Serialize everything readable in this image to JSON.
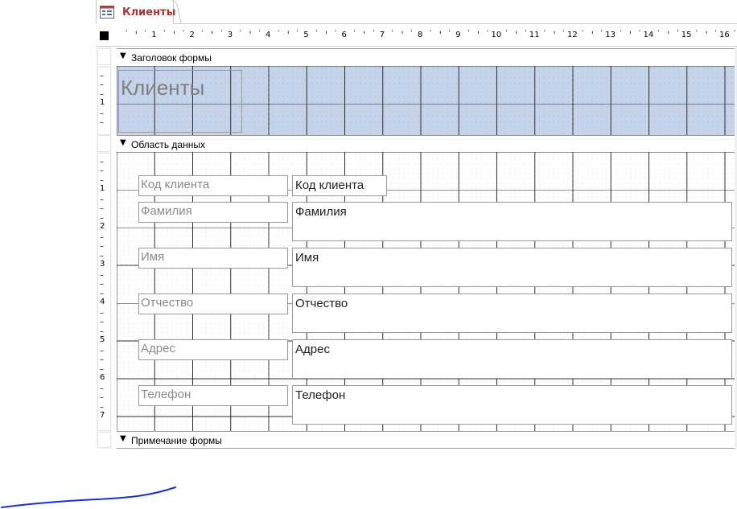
{
  "tab": {
    "title": "Клиенты",
    "icon": "form-icon"
  },
  "ruler": {
    "top_numbers": [
      "1",
      "2",
      "3",
      "4",
      "5",
      "6",
      "7",
      "8",
      "9",
      "10",
      "11",
      "12",
      "13",
      "14",
      "15",
      "16"
    ],
    "left_header_numbers": [
      "1"
    ],
    "left_detail_numbers": [
      "1",
      "2",
      "3",
      "4",
      "5",
      "6",
      "7"
    ]
  },
  "sections": {
    "header": "Заголовок формы",
    "detail": "Область данных",
    "footer": "Примечание формы"
  },
  "form_title": "Клиенты",
  "fields": [
    {
      "label": "Код клиента",
      "control": "Код клиента"
    },
    {
      "label": "Фамилия",
      "control": "Фамилия"
    },
    {
      "label": "Имя",
      "control": "Имя"
    },
    {
      "label": "Отчество",
      "control": "Отчество"
    },
    {
      "label": "Адрес",
      "control": "Адрес"
    },
    {
      "label": "Телефон",
      "control": "Телефон"
    }
  ],
  "colors": {
    "tab_title": "#a4373a",
    "header_fill": "#c5d4ea",
    "pen_stroke": "#1a2fd6"
  }
}
